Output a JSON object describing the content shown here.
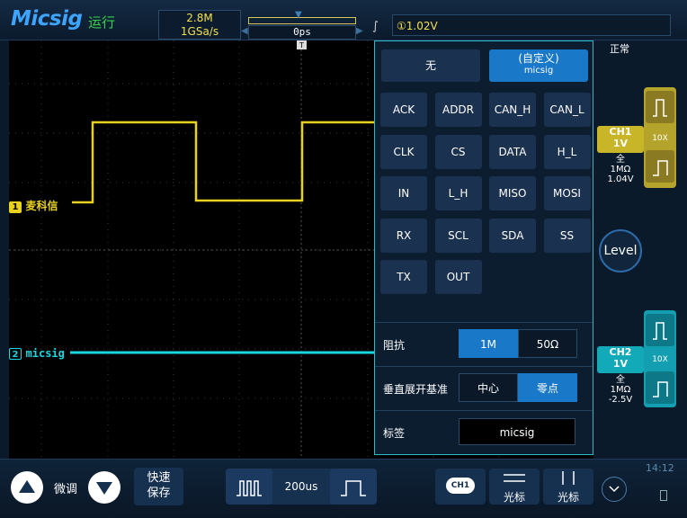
{
  "header": {
    "logo": "Micsig",
    "run_state": "运行",
    "memory_depth": "2.8M",
    "sample_rate": "1GSa/s",
    "time_offset": "0ps",
    "trigger_slope": "∫",
    "trigger_level": "①1.02V"
  },
  "status": "正常",
  "channels": {
    "ch1": {
      "label": "麦科信",
      "name": "CH1",
      "scale": "1V",
      "bw": "全",
      "impedance": "1MΩ",
      "offset": "1.04V",
      "probe": "10X",
      "marker": "1"
    },
    "ch2": {
      "label": "micsig",
      "name": "CH2",
      "scale": "1V",
      "bw": "全",
      "impedance": "1MΩ",
      "offset": "-2.5V",
      "probe": "10X",
      "marker": "2"
    }
  },
  "menu": {
    "none_label": "无",
    "custom_label": "(自定义)",
    "custom_value": "micsig",
    "presets": [
      "ACK",
      "ADDR",
      "CAN_H",
      "CAN_L",
      "CLK",
      "CS",
      "DATA",
      "H_L",
      "IN",
      "L_H",
      "MISO",
      "MOSI",
      "RX",
      "SCL",
      "SDA",
      "SS",
      "TX",
      "OUT"
    ],
    "impedance": {
      "label": "阻抗",
      "options": [
        "1M",
        "50Ω"
      ],
      "selected": "1M"
    },
    "vertical_ref": {
      "label": "垂直展开基准",
      "options": [
        "中心",
        "零点"
      ],
      "selected": "零点"
    },
    "tag": {
      "label": "标签",
      "value": "micsig"
    }
  },
  "level_label": "Level",
  "bottom": {
    "fine": "微调",
    "quick_save_1": "快速",
    "quick_save_2": "保存",
    "timebase": "200us",
    "ch_button": "CH1",
    "cursor1": "光标",
    "cursor2": "光标",
    "clock": "14:12"
  },
  "colors": {
    "ch1": "#e8d21e",
    "ch2": "#19d6e0",
    "accent": "#1a78c8"
  }
}
